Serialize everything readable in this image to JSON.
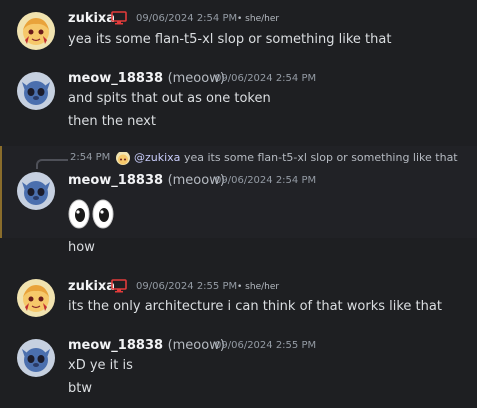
{
  "colors": {
    "background": "#1e1f22",
    "username": "#f2f3f5",
    "timestamp": "#949ba4",
    "message": "#dbdee1",
    "highlight_border": "#8a6d2b",
    "monitor_icon": "#e23b3b"
  },
  "messages": [
    {
      "user": "zukixa",
      "badge_icon": "monitor-icon",
      "timestamp": "09/06/2024 2:54 PM",
      "pronouns": "• she/her",
      "lines": [
        "yea its some flan-t5-xl slop or something like that"
      ]
    },
    {
      "user": "meow_18838",
      "nickname": "(meoow)",
      "timestamp": "09/06/2024 2:54 PM",
      "lines": [
        "and spits that out as one token",
        "then the next"
      ]
    },
    {
      "reply": {
        "timestamp": "2:54 PM",
        "mention": "@zukixa",
        "text": "yea its some flan-t5-xl slop or something like that"
      },
      "user": "meow_18838",
      "nickname": "(meoow)",
      "timestamp": "09/06/2024 2:54 PM",
      "emoji": "eyes-emoji",
      "lines": [
        "how"
      ]
    },
    {
      "user": "zukixa",
      "badge_icon": "monitor-icon",
      "timestamp": "09/06/2024 2:55 PM",
      "pronouns": "• she/her",
      "lines": [
        "its the only architecture i can think of that works like that"
      ]
    },
    {
      "user": "meow_18838",
      "nickname": "(meoow)",
      "timestamp": "09/06/2024 2:55 PM",
      "lines": [
        "xD ye it is",
        "btw"
      ]
    }
  ]
}
